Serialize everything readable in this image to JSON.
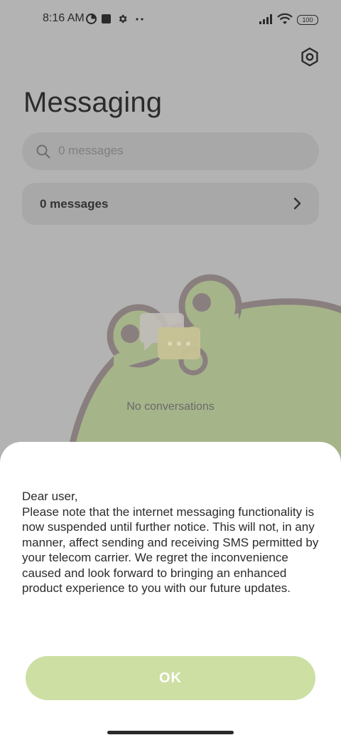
{
  "status_bar": {
    "time": "8:16 AM",
    "battery": "100",
    "icons": [
      "data-saver-icon",
      "square-notification-icon",
      "gear-icon",
      "more-dots-icon",
      "signal-icon",
      "wifi-icon",
      "battery-icon"
    ]
  },
  "header": {
    "title": "Messaging",
    "settings_icon": "settings-hex-icon"
  },
  "search": {
    "placeholder": "0 messages"
  },
  "summary": {
    "label": "0 messages"
  },
  "empty_state": {
    "text": "No conversations",
    "illustration": "frog-with-chat-bubbles"
  },
  "dialog": {
    "message": "Dear user,\nPlease note that the internet messaging functionality is now suspended until further notice. This will not, in any manner, affect sending and receiving SMS permitted by your telecom carrier. We regret the inconvenience caused and look forward to bringing an enhanced product experience to you with our future updates.",
    "ok_label": "OK"
  },
  "colors": {
    "scrim_background": "#b3b3b3",
    "dialog_background": "#ffffff",
    "ok_button": "#cddfa3",
    "frog_body": "#a6b48a",
    "frog_outline": "#8a7f7f"
  }
}
